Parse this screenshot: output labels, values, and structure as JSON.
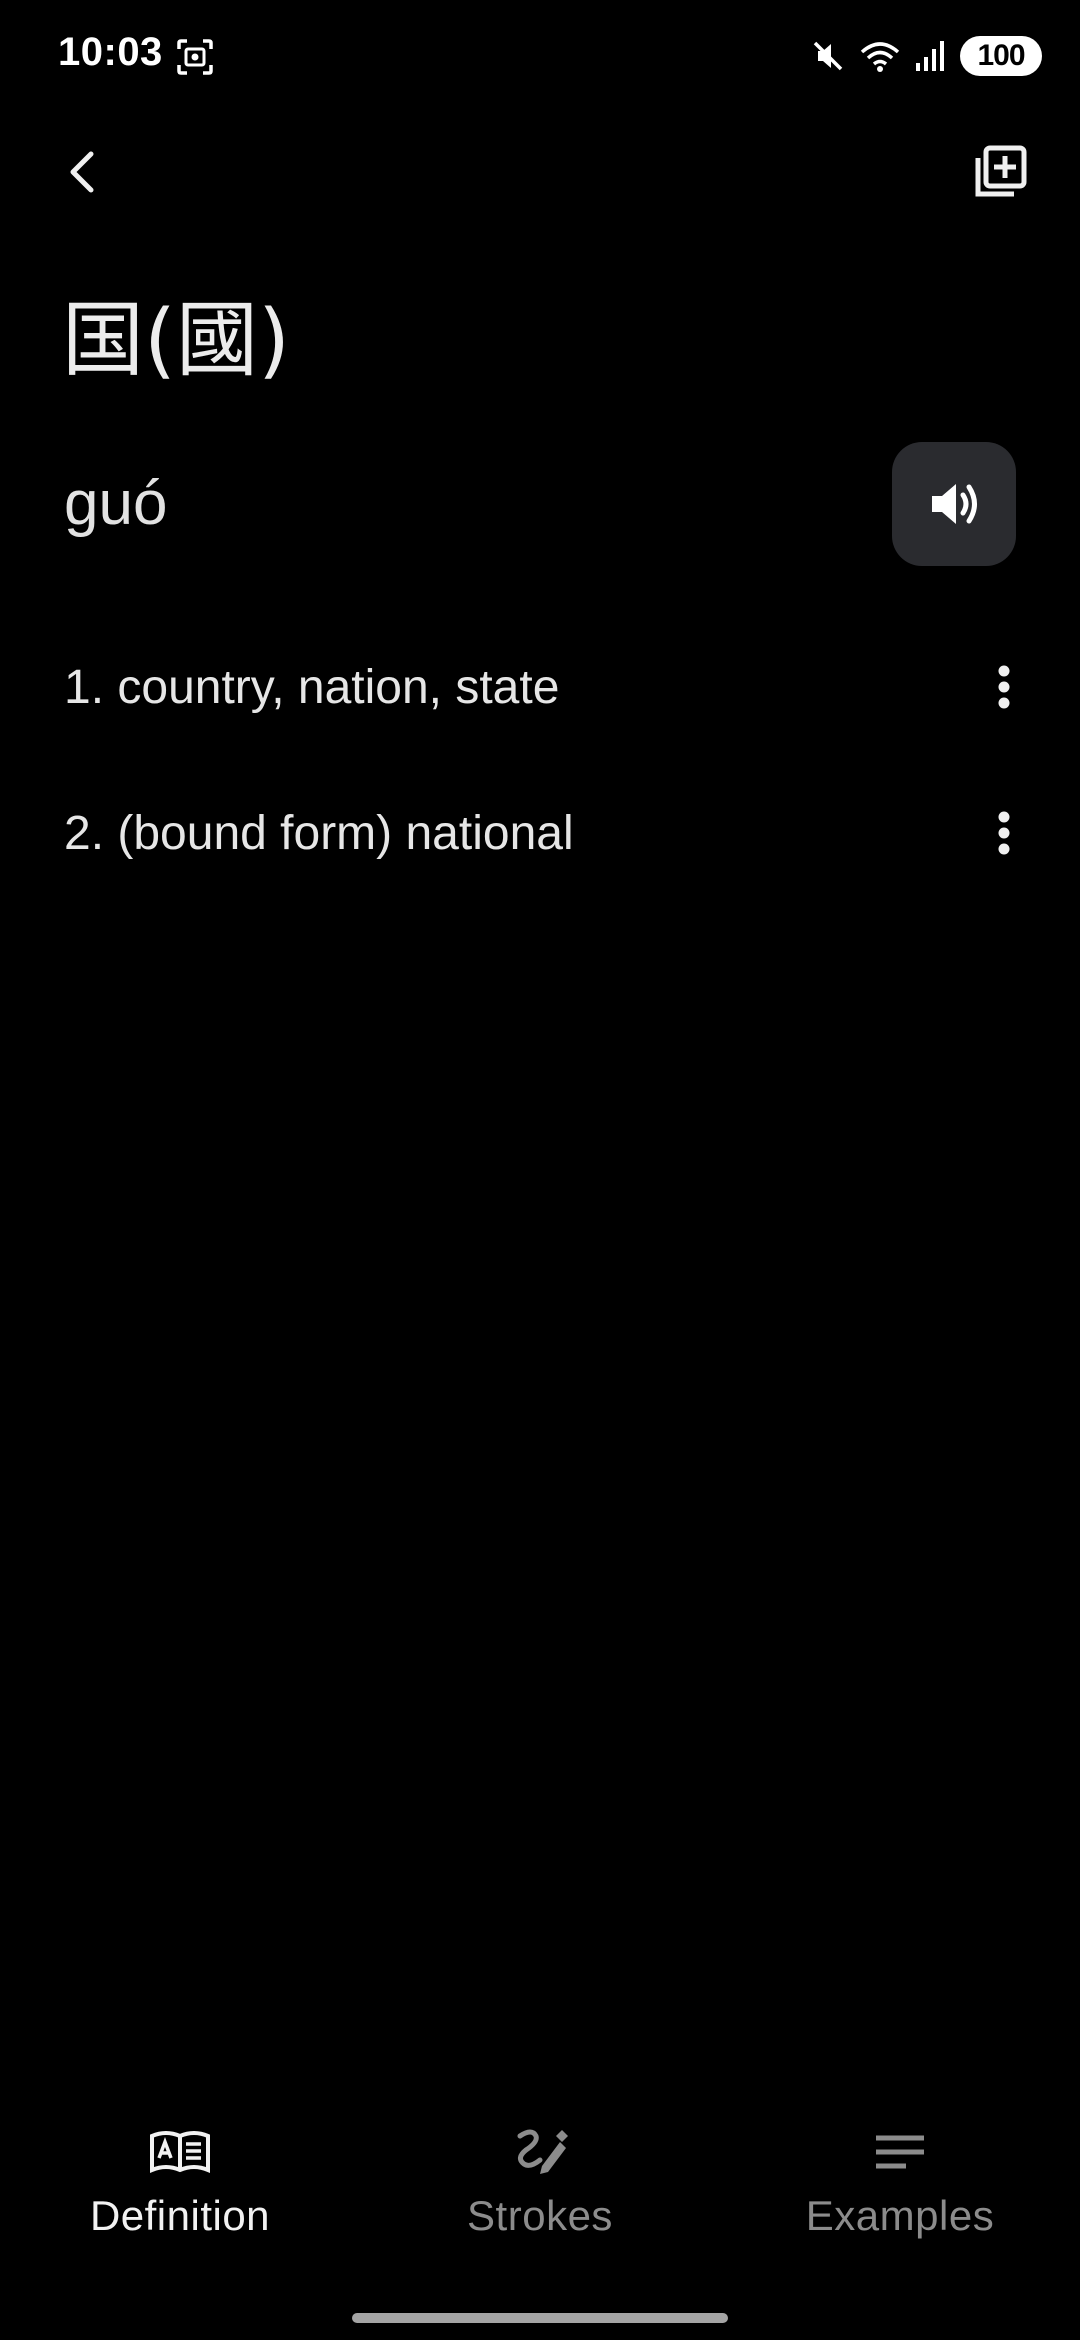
{
  "status_bar": {
    "time": "10:03",
    "battery": "100",
    "icons": [
      "screenshot-icon",
      "mute-icon",
      "wifi-icon",
      "signal-icon",
      "battery-icon"
    ]
  },
  "app_bar": {
    "back_icon": "chevron-left-icon",
    "add_icon": "add-to-library-icon"
  },
  "entry": {
    "headword": "国(國)",
    "pinyin": "guó",
    "audio_icon": "speaker-icon",
    "definitions": [
      {
        "text": "1. country, nation, state"
      },
      {
        "text": "2. (bound form) national"
      }
    ]
  },
  "bottom_nav": {
    "items": [
      {
        "label": "Definition",
        "icon": "book-icon",
        "active": true
      },
      {
        "label": "Strokes",
        "icon": "brush-icon",
        "active": false
      },
      {
        "label": "Examples",
        "icon": "lines-icon",
        "active": false
      }
    ]
  },
  "colors": {
    "background": "#000000",
    "text": "#e6e6e6",
    "inactive": "#8c8c8c",
    "button_bg": "#2a2b2f"
  }
}
